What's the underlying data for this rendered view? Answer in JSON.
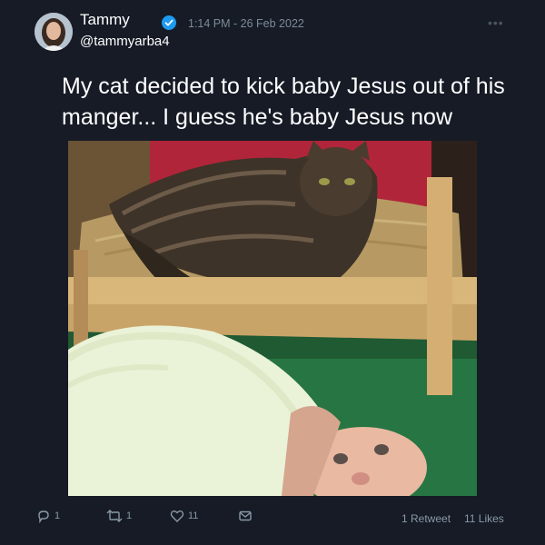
{
  "author": {
    "name": "Tammy",
    "handle": "@tammyarba4",
    "verified": true
  },
  "timestamp": "1:14 PM - 26 Feb 2022",
  "tweet_text": "My cat decided to kick baby Jesus out of his manger... I guess he's baby Jesus now",
  "actions": {
    "reply_count": "1",
    "retweet_count": "1",
    "like_count": "11"
  },
  "stats": {
    "retweets": "1 Retweet",
    "likes": "11 Likes"
  },
  "icons": [
    "verified-badge-icon",
    "more-icon",
    "reply-icon",
    "retweet-icon",
    "like-icon",
    "share-icon"
  ],
  "colors": {
    "background": "#161b26",
    "verified": "#1d9bf0",
    "muted": "#8899a6"
  }
}
